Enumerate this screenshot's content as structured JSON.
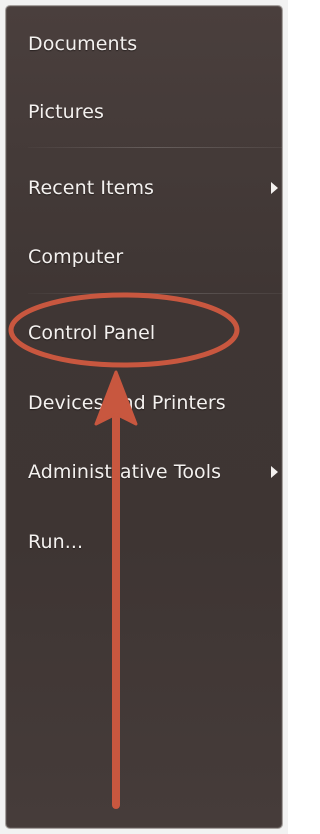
{
  "start_menu": {
    "items": [
      {
        "label": "Documents",
        "has_submenu": false
      },
      {
        "label": "Pictures",
        "has_submenu": false
      },
      {
        "label": "Recent Items",
        "has_submenu": true
      },
      {
        "label": "Computer",
        "has_submenu": false
      },
      {
        "label": "Control Panel",
        "has_submenu": false,
        "highlighted": true
      },
      {
        "label": "Devices and Printers",
        "has_submenu": false
      },
      {
        "label": "Administrative Tools",
        "has_submenu": true
      },
      {
        "label": "Run...",
        "has_submenu": false
      }
    ]
  },
  "annotation": {
    "color": "#c8573f",
    "target": "Control Panel",
    "shapes": [
      "ellipse",
      "arrow-up"
    ]
  }
}
